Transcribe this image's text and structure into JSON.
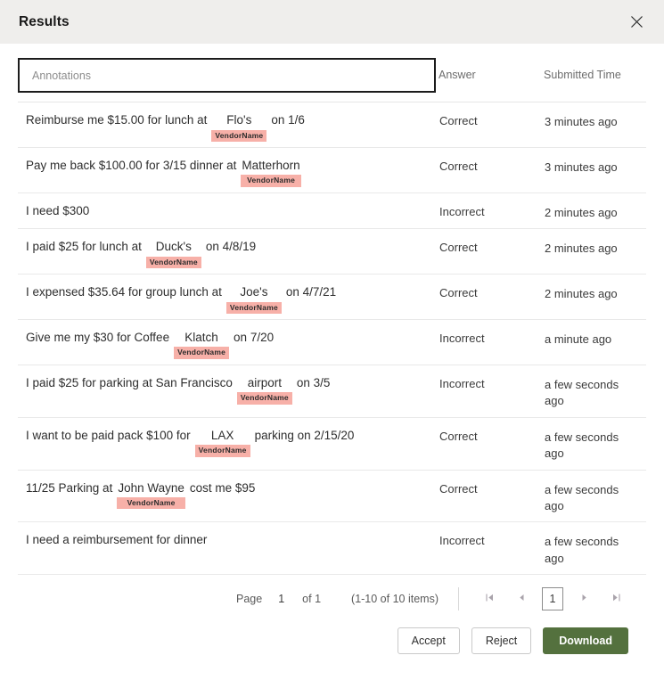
{
  "header": {
    "title": "Results",
    "close_icon": "close-icon"
  },
  "search": {
    "placeholder": "Annotations",
    "value": ""
  },
  "table": {
    "columns": {
      "annotations": "Annotations",
      "answer": "Answer",
      "submitted_time": "Submitted Time"
    },
    "entity_tag_color": "#f7b0a8",
    "rows": [
      {
        "segments": [
          {
            "type": "text",
            "text": "Reimburse me $15.00 for lunch at"
          },
          {
            "type": "entity",
            "text": "Flo's",
            "tag": "VendorName"
          },
          {
            "type": "text",
            "text": "on 1/6"
          }
        ],
        "answer": "Correct",
        "time": "3 minutes ago"
      },
      {
        "segments": [
          {
            "type": "text",
            "text": "Pay me back $100.00 for 3/15 dinner at"
          },
          {
            "type": "entity",
            "text": "Matterhorn",
            "tag": "VendorName"
          }
        ],
        "answer": "Correct",
        "time": "3 minutes ago"
      },
      {
        "segments": [
          {
            "type": "text",
            "text": "I need $300"
          }
        ],
        "answer": "Incorrect",
        "time": "2 minutes ago"
      },
      {
        "segments": [
          {
            "type": "text",
            "text": "I paid $25 for lunch at"
          },
          {
            "type": "entity",
            "text": "Duck's",
            "tag": "VendorName"
          },
          {
            "type": "text",
            "text": "on 4/8/19"
          }
        ],
        "answer": "Correct",
        "time": "2 minutes ago"
      },
      {
        "segments": [
          {
            "type": "text",
            "text": "I expensed $35.64 for group lunch at"
          },
          {
            "type": "entity",
            "text": "Joe's",
            "tag": "VendorName"
          },
          {
            "type": "text",
            "text": "on 4/7/21"
          }
        ],
        "answer": "Correct",
        "time": "2 minutes ago"
      },
      {
        "segments": [
          {
            "type": "text",
            "text": "Give me my $30 for Coffee"
          },
          {
            "type": "entity",
            "text": "Klatch",
            "tag": "VendorName"
          },
          {
            "type": "text",
            "text": "on 7/20"
          }
        ],
        "answer": "Incorrect",
        "time": "a minute ago"
      },
      {
        "segments": [
          {
            "type": "text",
            "text": "I paid $25 for parking at San Francisco"
          },
          {
            "type": "entity",
            "text": "airport",
            "tag": "VendorName"
          },
          {
            "type": "text",
            "text": "on 3/5"
          }
        ],
        "answer": "Incorrect",
        "time": "a few seconds ago"
      },
      {
        "segments": [
          {
            "type": "text",
            "text": "I want to be paid pack $100 for"
          },
          {
            "type": "entity",
            "text": "LAX",
            "tag": "VendorName"
          },
          {
            "type": "text",
            "text": "parking on 2/15/20"
          }
        ],
        "answer": "Correct",
        "time": "a few seconds ago"
      },
      {
        "segments": [
          {
            "type": "text",
            "text": "11/25 Parking at"
          },
          {
            "type": "entity",
            "text": "John Wayne",
            "tag": "VendorName"
          },
          {
            "type": "text",
            "text": "cost me $95"
          }
        ],
        "answer": "Correct",
        "time": "a few seconds ago"
      },
      {
        "segments": [
          {
            "type": "text",
            "text": "I need a reimbursement for dinner"
          }
        ],
        "answer": "Incorrect",
        "time": "a few seconds ago"
      }
    ]
  },
  "pagination": {
    "page_label": "Page",
    "current_page": "1",
    "of_label": "of 1",
    "items_label": "(1-10 of 10 items)",
    "first_icon": "first-page-icon",
    "prev_icon": "previous-page-icon",
    "page_number": "1",
    "next_icon": "next-page-icon",
    "last_icon": "last-page-icon"
  },
  "footer": {
    "accept_label": "Accept",
    "reject_label": "Reject",
    "download_label": "Download",
    "download_color": "#54713e"
  }
}
